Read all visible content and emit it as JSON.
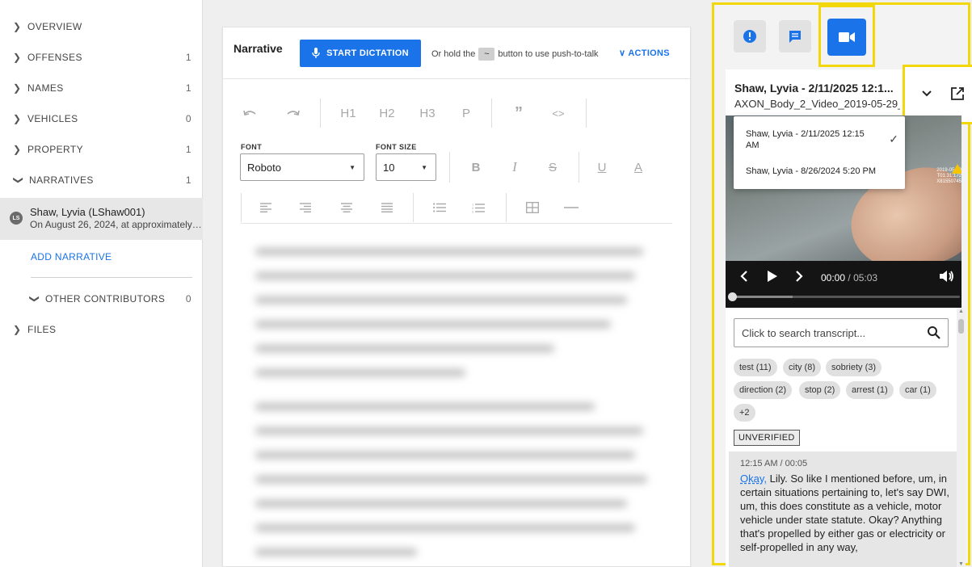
{
  "sidebar": {
    "sections": [
      {
        "label": "OVERVIEW",
        "count": ""
      },
      {
        "label": "OFFENSES",
        "count": "1"
      },
      {
        "label": "NAMES",
        "count": "1"
      },
      {
        "label": "VEHICLES",
        "count": "0"
      },
      {
        "label": "PROPERTY",
        "count": "1"
      },
      {
        "label": "NARRATIVES",
        "count": "1"
      }
    ],
    "narrative": {
      "avatar": "LS",
      "name": "Shaw, Lyvia (LShaw001)",
      "preview": "On August 26, 2024, at approximately 10..."
    },
    "add_narrative": "ADD NARRATIVE",
    "other_contributors": {
      "label": "OTHER CONTRIBUTORS",
      "count": "0"
    },
    "files": {
      "label": "FILES"
    }
  },
  "editor": {
    "title": "Narrative",
    "dictation_button": "START DICTATION",
    "hold_prefix": "Or hold the",
    "hold_key": "~",
    "hold_suffix": "button to use push-to-talk",
    "actions": "ACTIONS",
    "toolbar": {
      "h1": "H1",
      "h2": "H2",
      "h3": "H3",
      "p": "P",
      "quote": "”",
      "code": "<>",
      "font_label": "FONT",
      "font_value": "Roboto",
      "font_size_label": "FONT SIZE",
      "font_size_value": "10",
      "bold": "B",
      "italic": "I",
      "strike": "S",
      "underline": "U",
      "color": "A"
    }
  },
  "video_panel": {
    "title": "Shaw, Lyvia - 2/11/2025 12:1...",
    "file": "AXON_Body_2_Video_2019-05-29_...",
    "dropdown": [
      {
        "label": "Shaw, Lyvia - 2/11/2025 12:15 AM",
        "selected": true
      },
      {
        "label": "Shaw, Lyvia - 8/26/2024 5:20 PM",
        "selected": false
      }
    ],
    "video_stamp": "2019-05-29 T01:31:172 X81550745",
    "player": {
      "current": "00:00",
      "separator": "/",
      "duration": "05:03",
      "progress": 0.0
    },
    "search_placeholder": "Click to search transcript...",
    "chips": [
      "test (11)",
      "city (8)",
      "sobriety (3)",
      "direction (2)",
      "stop (2)",
      "arrest (1)",
      "car (1)",
      "+2"
    ],
    "unverified": "UNVERIFIED",
    "segment": {
      "time": "12:15 AM / 00:05",
      "highlight": "Okay,",
      "text": " Lily. So like I mentioned before, um, in certain situations pertaining to, let's say DWI, um, this does constitute as a vehicle, motor vehicle under state statute. Okay? Anything that's propelled by either gas or electricity or self-propelled in any way,"
    }
  },
  "colors": {
    "accent": "#1a73e8",
    "highlight_border": "#f2d70b"
  }
}
